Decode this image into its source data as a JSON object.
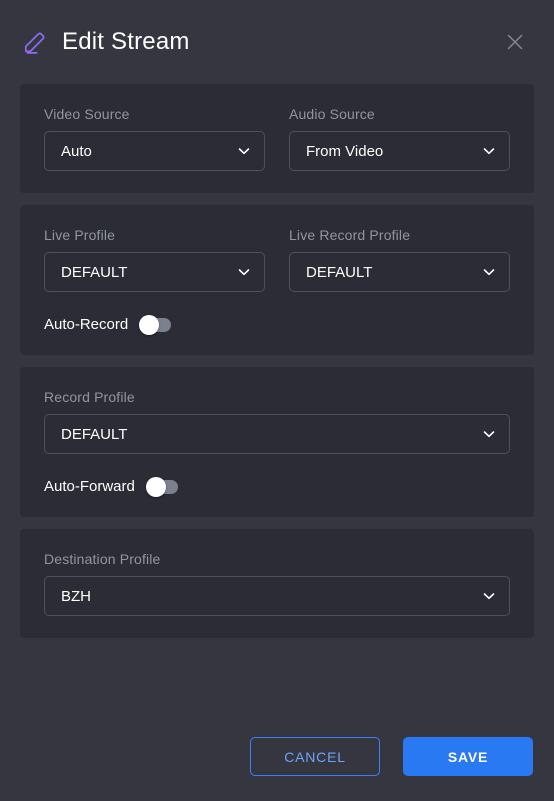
{
  "header": {
    "title": "Edit Stream",
    "edit_icon": "pencil-icon",
    "close_icon": "close-icon",
    "accent_color": "#8b6cef"
  },
  "cards": [
    {
      "id": "source-card",
      "fields": [
        {
          "label": "Video Source",
          "value": "Auto"
        },
        {
          "label": "Audio Source",
          "value": "From Video"
        }
      ]
    },
    {
      "id": "live-card",
      "fields": [
        {
          "label": "Live Profile",
          "value": "DEFAULT"
        },
        {
          "label": "Live Record Profile",
          "value": "DEFAULT"
        }
      ],
      "toggle": {
        "label": "Auto-Record",
        "state": "off"
      }
    },
    {
      "id": "record-card",
      "fields": [
        {
          "label": "Record Profile",
          "value": "DEFAULT"
        }
      ],
      "toggle": {
        "label": "Auto-Forward",
        "state": "off"
      }
    },
    {
      "id": "destination-card",
      "fields": [
        {
          "label": "Destination Profile",
          "value": "BZH"
        }
      ]
    }
  ],
  "footer": {
    "cancel_label": "CANCEL",
    "save_label": "SAVE",
    "primary_color": "#2979f2"
  },
  "colors": {
    "page_bg": "#35363f",
    "card_bg": "#2b2c35",
    "border": "#4d505d",
    "label": "#9195a2",
    "toggle_track": "#7b7f8e"
  }
}
